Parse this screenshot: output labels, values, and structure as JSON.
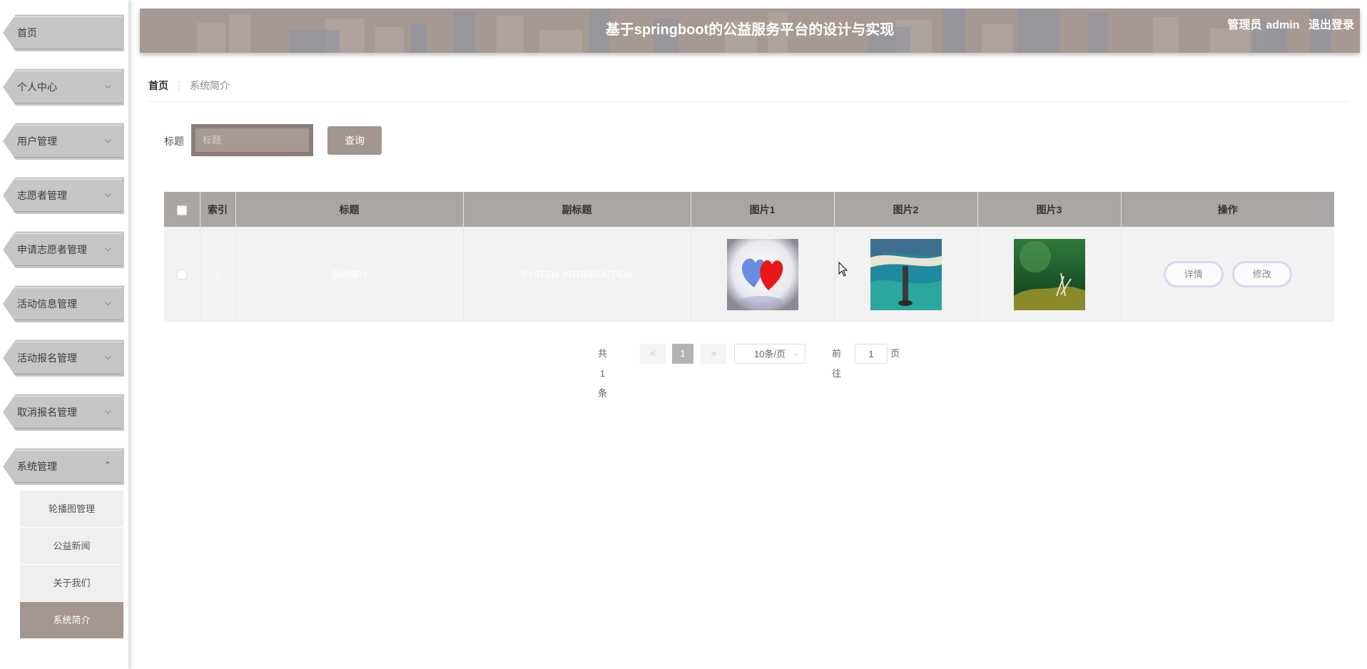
{
  "sidebar": {
    "items": [
      {
        "label": "首页",
        "chevron": ""
      },
      {
        "label": "个人中心",
        "chevron": "⌵"
      },
      {
        "label": "用户管理",
        "chevron": "⌵"
      },
      {
        "label": "志愿者管理",
        "chevron": "⌵"
      },
      {
        "label": "申请志愿者管理",
        "chevron": "⌵"
      },
      {
        "label": "活动信息管理",
        "chevron": "⌵"
      },
      {
        "label": "活动报名管理",
        "chevron": "⌵"
      },
      {
        "label": "取消报名管理",
        "chevron": "⌵"
      },
      {
        "label": "系统管理",
        "chevron": "⌃"
      }
    ],
    "submenu": [
      {
        "label": "轮播图管理"
      },
      {
        "label": "公益新闻"
      },
      {
        "label": "关于我们"
      },
      {
        "label": "系统简介",
        "active": true
      }
    ]
  },
  "header": {
    "title": "基于springboot的公益服务平台的设计与实现",
    "user_role": "管理员",
    "user_name": "admin",
    "logout_label": "退出登录"
  },
  "breadcrumb": {
    "home": "首页",
    "separator": "⋮",
    "current": "系统简介"
  },
  "search": {
    "label": "标题",
    "placeholder": "标题",
    "button_label": "查询"
  },
  "table": {
    "columns": [
      "索引",
      "标题",
      "副标题",
      "图片1",
      "图片2",
      "图片3",
      "操作"
    ],
    "rows": [
      {
        "index": "1",
        "title": "系统简介",
        "subtitle": "SYSTEM INTRODUCTION",
        "images": [
          "hearts-image",
          "lighthouse-image",
          "plant-image"
        ],
        "actions": [
          "详情",
          "修改"
        ]
      }
    ]
  },
  "pagination": {
    "total": "共 1 条",
    "prev": "<",
    "current_page": "1",
    "next": ">",
    "page_size": "10条/页",
    "goto_label": "前往",
    "goto_value": "1",
    "page_suffix": "页"
  },
  "colors": {
    "accent": "#a39590",
    "header_bg": "#a69893",
    "table_header": "#a9a6a4"
  }
}
